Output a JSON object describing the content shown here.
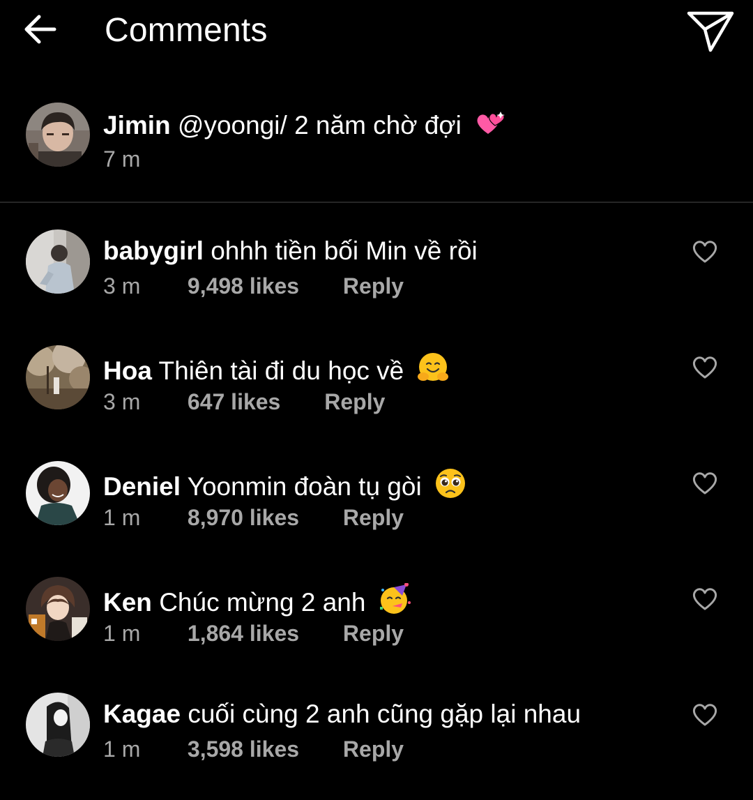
{
  "header": {
    "title": "Comments",
    "back_icon": "arrow-left-icon",
    "send_icon": "paper-plane-icon"
  },
  "caption": {
    "username": "Jimin",
    "text": "@yoongi/ 2 năm chờ đợi",
    "emoji": "two-hearts",
    "time": "7 m"
  },
  "comments": [
    {
      "username": "babygirl",
      "text": "ohhh tiền bối Min về rồi",
      "emoji": "",
      "time": "3 m",
      "likes": "9,498 likes",
      "reply": "Reply"
    },
    {
      "username": "Hoa",
      "text": "Thiên tài đi du học về",
      "emoji": "hugging-face",
      "time": "3 m",
      "likes": "647 likes",
      "reply": "Reply"
    },
    {
      "username": "Deniel",
      "text": "Yoonmin đoàn tụ gòi",
      "emoji": "pleading-face",
      "time": "1 m",
      "likes": "8,970 likes",
      "reply": "Reply"
    },
    {
      "username": "Ken",
      "text": "Chúc mừng 2 anh",
      "emoji": "partying-face",
      "time": "1 m",
      "likes": "1,864 likes",
      "reply": "Reply"
    },
    {
      "username": "Kagae",
      "text": "cuối cùng 2 anh cũng gặp lại nhau",
      "emoji": "",
      "time": "1 m",
      "likes": "3,598 likes",
      "reply": "Reply"
    }
  ],
  "colors": {
    "background": "#000000",
    "text": "#ffffff",
    "secondary_text": "#a8a8a8",
    "divider": "#262626"
  }
}
